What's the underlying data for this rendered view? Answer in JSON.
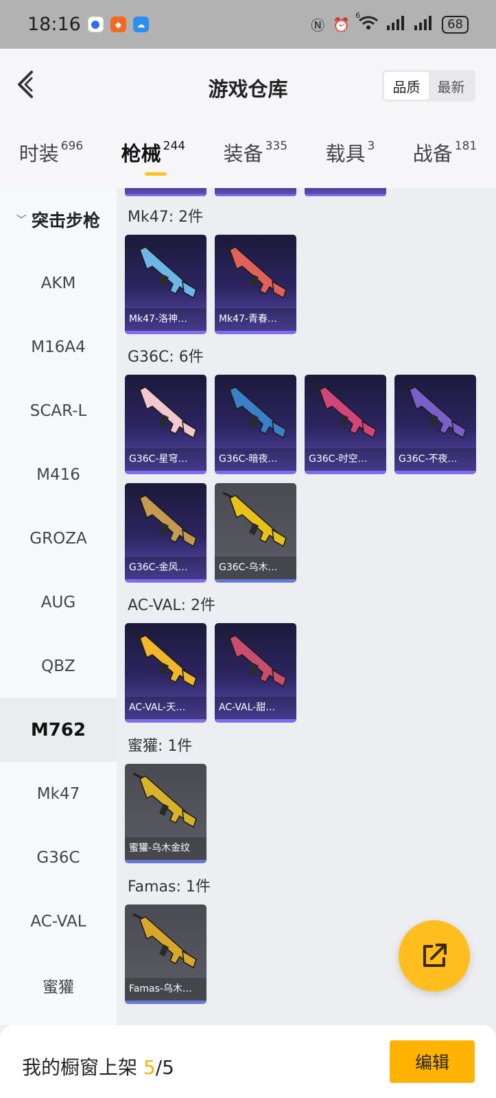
{
  "status": {
    "time": "18:16",
    "network_label": "6",
    "battery": "68"
  },
  "header": {
    "title": "游戏仓库",
    "sort": [
      "品质",
      "最新"
    ]
  },
  "tabs": [
    {
      "label": "时装",
      "count": "696"
    },
    {
      "label": "枪械",
      "count": "244"
    },
    {
      "label": "装备",
      "count": "335"
    },
    {
      "label": "载具",
      "count": "3"
    },
    {
      "label": "战备",
      "count": "181"
    }
  ],
  "sidebar": {
    "category": "突击步枪",
    "items": [
      "AKM",
      "M16A4",
      "SCAR-L",
      "M416",
      "GROZA",
      "AUG",
      "QBZ",
      "M762",
      "Mk47",
      "G36C",
      "AC-VAL",
      "蜜獾"
    ],
    "active": "M762"
  },
  "groups": [
    {
      "label": "Mk47: 2件",
      "items": [
        {
          "name": "Mk47-洛神…",
          "style": "purple",
          "color": "#6fb6e8"
        },
        {
          "name": "Mk47-青春…",
          "style": "purple",
          "color": "#e0605a"
        }
      ]
    },
    {
      "label": "G36C: 6件",
      "items": [
        {
          "name": "G36C-星穹…",
          "style": "purple",
          "color": "#f2c7cf"
        },
        {
          "name": "G36C-暗夜…",
          "style": "purple",
          "color": "#3b7fc8"
        },
        {
          "name": "G36C-时空…",
          "style": "purple",
          "color": "#d2457a"
        },
        {
          "name": "G36C-不夜…",
          "style": "purple",
          "color": "#7a5fc8"
        },
        {
          "name": "G36C-金风…",
          "style": "purple",
          "color": "#c59a52"
        },
        {
          "name": "G36C-乌木…",
          "style": "gray",
          "color": "#e8c21a"
        }
      ]
    },
    {
      "label": "AC-VAL: 2件",
      "items": [
        {
          "name": "AC-VAL-天…",
          "style": "purple",
          "color": "#f0b72a"
        },
        {
          "name": "AC-VAL-甜…",
          "style": "purple",
          "color": "#c84d6e"
        }
      ]
    },
    {
      "label": "蜜獾: 1件",
      "items": [
        {
          "name": "蜜獾-乌木金纹",
          "style": "gray",
          "color": "#d9b22a"
        }
      ]
    },
    {
      "label": "Famas: 1件",
      "items": [
        {
          "name": "Famas-乌木…",
          "style": "gray",
          "color": "#d9a72a"
        }
      ]
    }
  ],
  "bottom": {
    "label": "我的橱窗上架 ",
    "current": "5",
    "sep": "/",
    "total": "5",
    "edit": "编辑"
  },
  "colors": {
    "accent": "#ffbe1d",
    "purple_card": "#2d2561",
    "gray_card": "#55565d"
  }
}
